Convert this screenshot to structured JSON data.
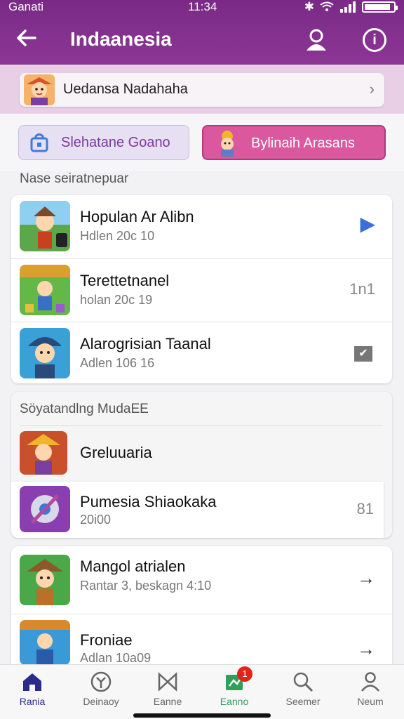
{
  "status_bar": {
    "carrier": "Ganati",
    "time": "11:34",
    "battery_level": 0.9
  },
  "app_bar": {
    "title": "Indaanesia"
  },
  "account": {
    "name": "Uedansa Nadahaha"
  },
  "actions": {
    "left_label": "Slehatane Goano",
    "right_label": "Bylinaih Arasans"
  },
  "section1": {
    "header": "Nase seiratnepuar",
    "rows": [
      {
        "title": "Hopulan Ar Alibn",
        "subtitle": "Hdlen 20c 10",
        "trail": "▶"
      },
      {
        "title": "Terettetnanel",
        "subtitle": "holan 20c 19",
        "trail": "1n1"
      },
      {
        "title": "Alarogrisian Taanal",
        "subtitle": "Adlen 106 16",
        "trail": "✔"
      }
    ]
  },
  "section2": {
    "header": "Söyatandlng MudaEE",
    "rows": [
      {
        "title": "Greluuaria",
        "subtitle": "",
        "trail": ""
      },
      {
        "title": "Pumesia Shiaokaka",
        "subtitle": "20i00",
        "trail": "81"
      }
    ]
  },
  "section3": {
    "rows": [
      {
        "title": "Mangol atrialen",
        "subtitle": "Rantar 3, beskagn 4:10",
        "trail": "→"
      },
      {
        "title": "Froniae",
        "subtitle": "Adlan 10a09",
        "trail": "→"
      }
    ]
  },
  "bottom_nav": [
    {
      "label": "Rania",
      "icon": "home-icon"
    },
    {
      "label": "Deinaoy",
      "icon": "compass-icon"
    },
    {
      "label": "Eanne",
      "icon": "bowtie-icon"
    },
    {
      "label": "Eanno",
      "icon": "flag-icon",
      "badge": "1"
    },
    {
      "label": "Seemer",
      "icon": "search-icon"
    },
    {
      "label": "Neum",
      "icon": "profile-icon"
    }
  ],
  "colors": {
    "primary": "#8c3696",
    "accent": "#d9589e",
    "nav_active": "#2a2a8a",
    "nav_green": "#2ea05a"
  }
}
